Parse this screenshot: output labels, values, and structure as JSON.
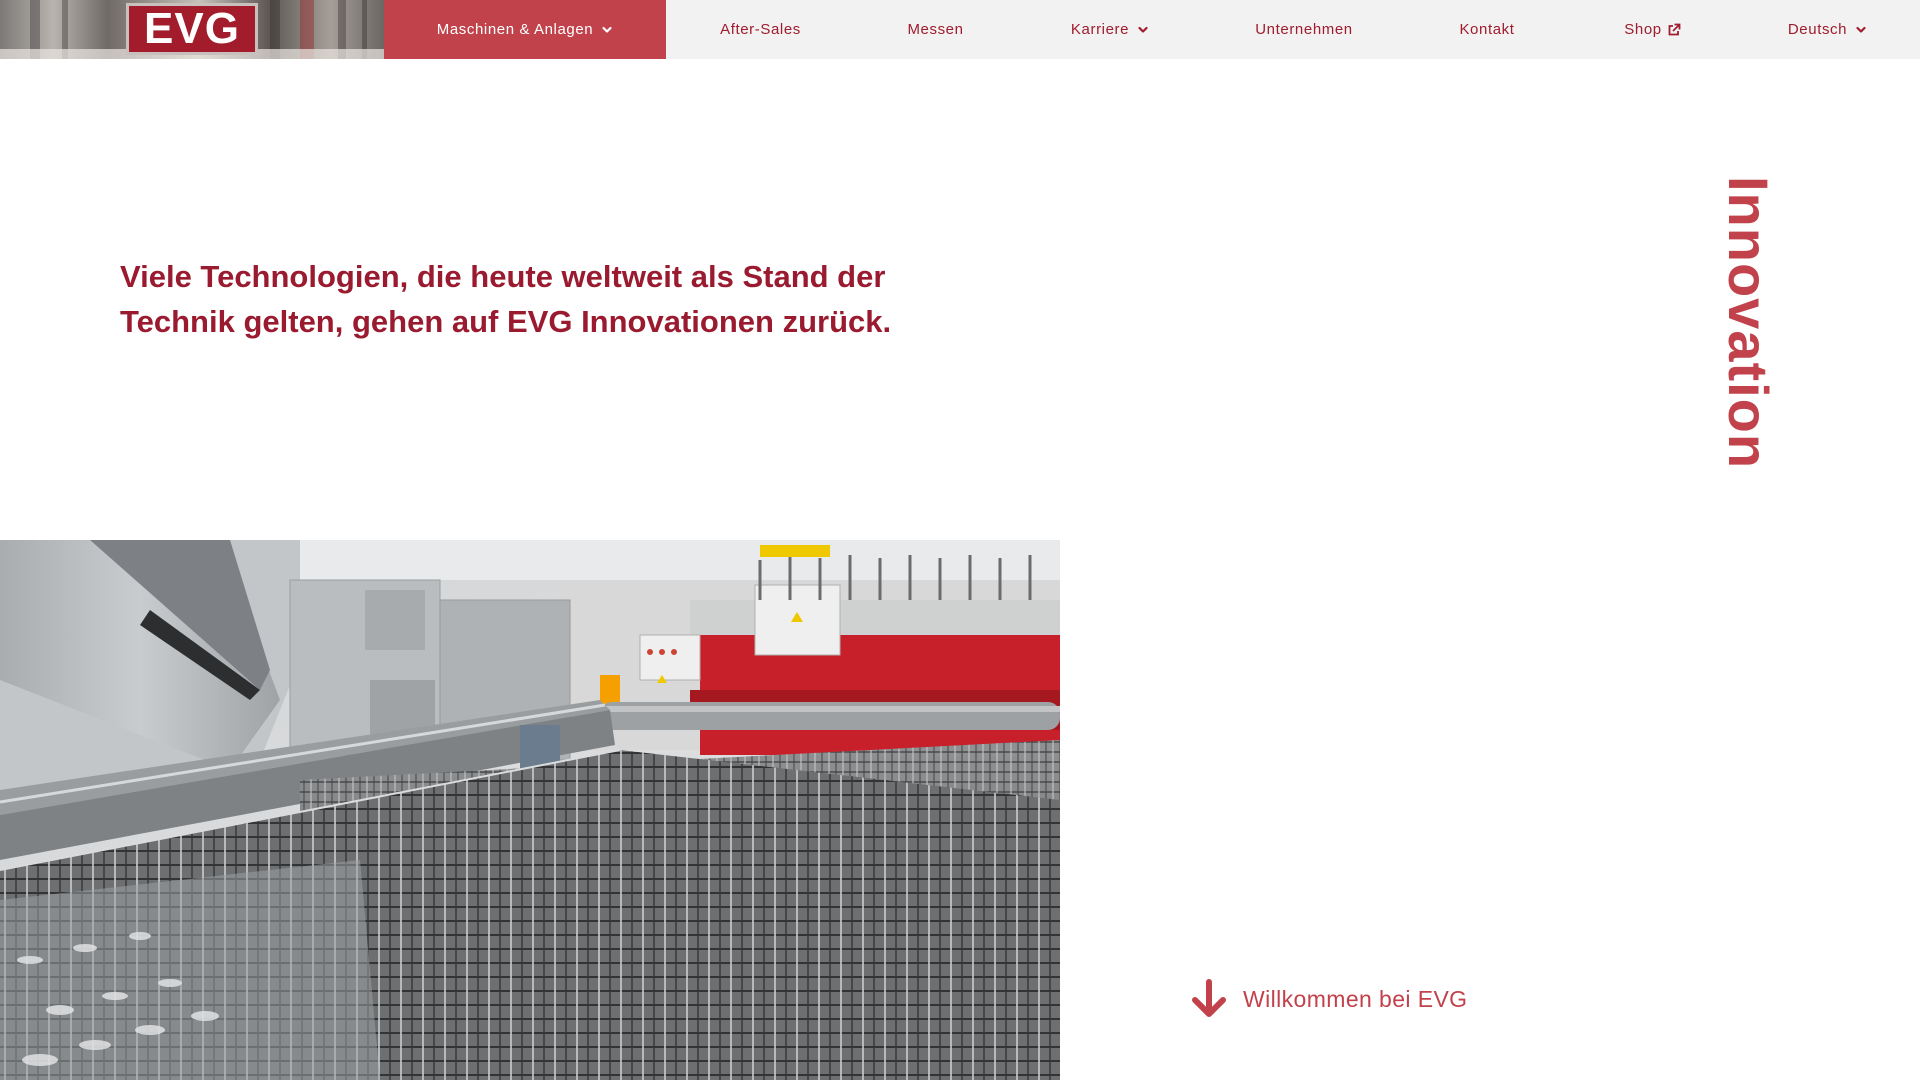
{
  "brand": {
    "logo_text": "EVG",
    "colors": {
      "primary": "#a01c2e",
      "accent": "#c1424b",
      "nav_background": "#f2f2f2"
    }
  },
  "nav": {
    "items": [
      {
        "label": "Maschinen & Anlagen",
        "active": true,
        "has_dropdown": true
      },
      {
        "label": "After-Sales",
        "active": false,
        "has_dropdown": false
      },
      {
        "label": "Messen",
        "active": false,
        "has_dropdown": false
      },
      {
        "label": "Karriere",
        "active": false,
        "has_dropdown": true
      },
      {
        "label": "Unternehmen",
        "active": false,
        "has_dropdown": false
      },
      {
        "label": "Kontakt",
        "active": false,
        "has_dropdown": false
      },
      {
        "label": "Shop",
        "active": false,
        "has_dropdown": false,
        "icon": "external-link-icon"
      }
    ],
    "language": {
      "label": "Deutsch",
      "icon": "chevron-down-icon"
    }
  },
  "hero": {
    "headline": "Viele Technologien, die heute weltweit als Stand der Technik gelten, gehen auf EVG Innovationen zurück.",
    "vertical_title": "Innovation"
  },
  "welcome_link": {
    "label": "Willkommen bei EVG",
    "icon": "arrow-down-icon"
  }
}
